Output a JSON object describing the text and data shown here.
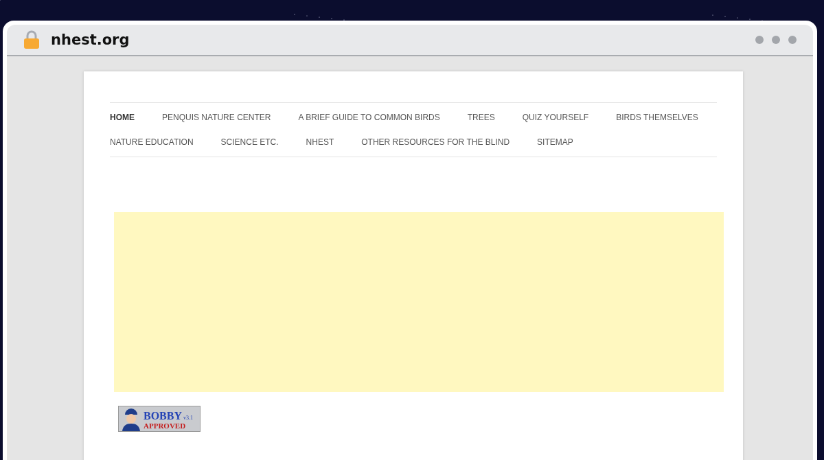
{
  "browser": {
    "address": "nhest.org",
    "secure": true
  },
  "nav": [
    {
      "label": "HOME",
      "selected": true
    },
    {
      "label": "PENQUIS NATURE CENTER",
      "selected": false
    },
    {
      "label": "A BRIEF GUIDE TO COMMON BIRDS",
      "selected": false
    },
    {
      "label": "TREES",
      "selected": false
    },
    {
      "label": "QUIZ YOURSELF",
      "selected": false
    },
    {
      "label": "BIRDS THEMSELVES",
      "selected": false
    },
    {
      "label": "NATURE EDUCATION",
      "selected": false
    },
    {
      "label": "SCIENCE ETC.",
      "selected": false
    },
    {
      "label": "NHEST",
      "selected": false
    },
    {
      "label": "OTHER RESOURCES FOR THE BLIND",
      "selected": false
    },
    {
      "label": "SITEMAP",
      "selected": false
    }
  ],
  "badge": {
    "title": "BOBBY",
    "version": "v3.1",
    "status": "APPROVED"
  }
}
